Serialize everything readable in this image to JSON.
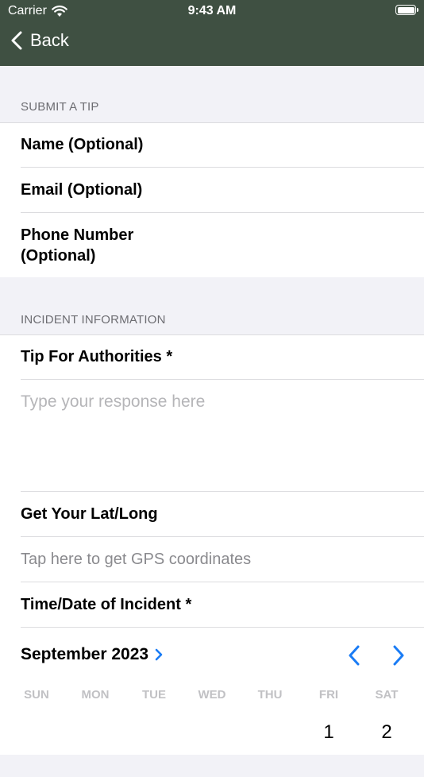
{
  "status_bar": {
    "carrier": "Carrier",
    "time": "9:43 AM"
  },
  "nav": {
    "back_label": "Back"
  },
  "section_tip": {
    "header": "SUBMIT A TIP",
    "rows": [
      "Name (Optional)",
      "Email (Optional)",
      "Phone Number",
      "(Optional)"
    ]
  },
  "section_incident": {
    "header": "INCIDENT INFORMATION",
    "tip_label": "Tip For Authorities *",
    "tip_placeholder": "Type your response here",
    "latlong_label": "Get Your Lat/Long",
    "latlong_hint": "Tap here to get GPS coordinates",
    "time_label": "Time/Date of Incident *"
  },
  "calendar": {
    "month": "September 2023",
    "weekdays": [
      "SUN",
      "MON",
      "TUE",
      "WED",
      "THU",
      "FRI",
      "SAT"
    ],
    "visible_days": [
      "1",
      "2"
    ]
  },
  "colors": {
    "nav_bar": "#3f5042",
    "accent": "#1a7cf5"
  }
}
